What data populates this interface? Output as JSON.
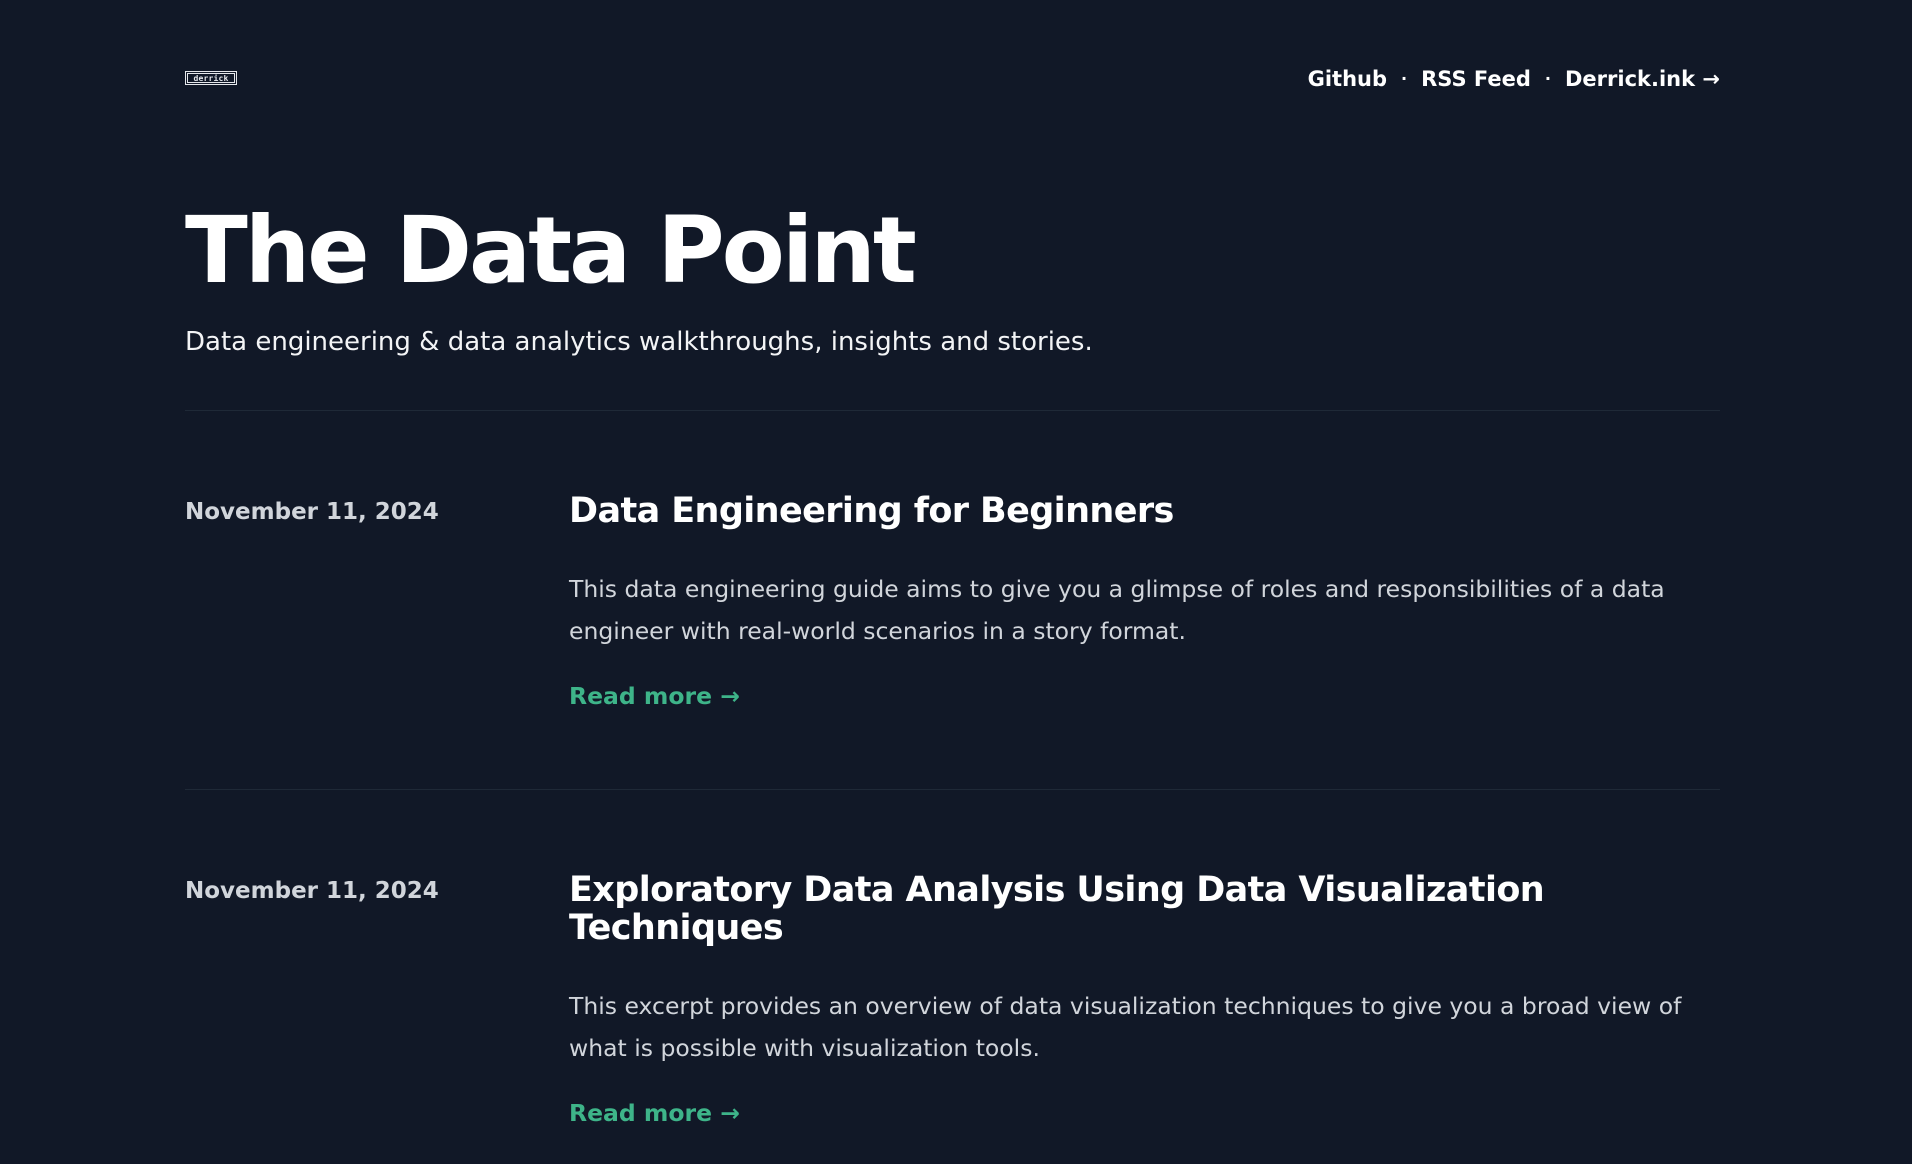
{
  "header": {
    "logo_text": "derrick",
    "nav": [
      {
        "label": "Github"
      },
      {
        "label": "RSS Feed"
      },
      {
        "label": "Derrick.ink →"
      }
    ],
    "separator": "·"
  },
  "hero": {
    "title": "The Data Point",
    "subtitle": "Data engineering & data analytics walkthroughs, insights and stories."
  },
  "posts": [
    {
      "date": "November 11, 2024",
      "title": "Data Engineering for Beginners",
      "excerpt": "This data engineering guide aims to give you a glimpse of roles and responsibilities of a data engineer with real-world scenarios in a story format.",
      "read_more": "Read more →"
    },
    {
      "date": "November 11, 2024",
      "title": "Exploratory Data Analysis Using Data Visualization Techniques",
      "excerpt": "This excerpt provides an overview of data visualization techniques to give you a broad view of what is possible with visualization tools.",
      "read_more": "Read more →"
    }
  ],
  "colors": {
    "background": "#111827",
    "accent": "#3eb489",
    "text": "#ffffff",
    "muted": "#d1d5db"
  }
}
